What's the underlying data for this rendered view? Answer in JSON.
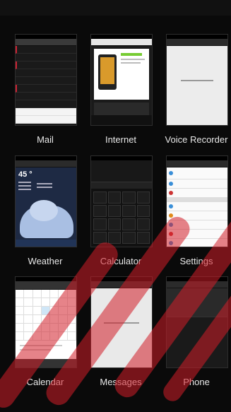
{
  "apps": [
    {
      "label": "Mail"
    },
    {
      "label": "Internet"
    },
    {
      "label": "Voice Recorder"
    },
    {
      "label": "Weather"
    },
    {
      "label": "Calculator"
    },
    {
      "label": "Settings"
    },
    {
      "label": "Calendar"
    },
    {
      "label": "Messages"
    },
    {
      "label": "Phone"
    }
  ],
  "weather": {
    "temperature": "45 °"
  },
  "colors": {
    "background": "#0a0a0a",
    "watermark": "#d21e28",
    "label_text": "#e8e8e8"
  }
}
